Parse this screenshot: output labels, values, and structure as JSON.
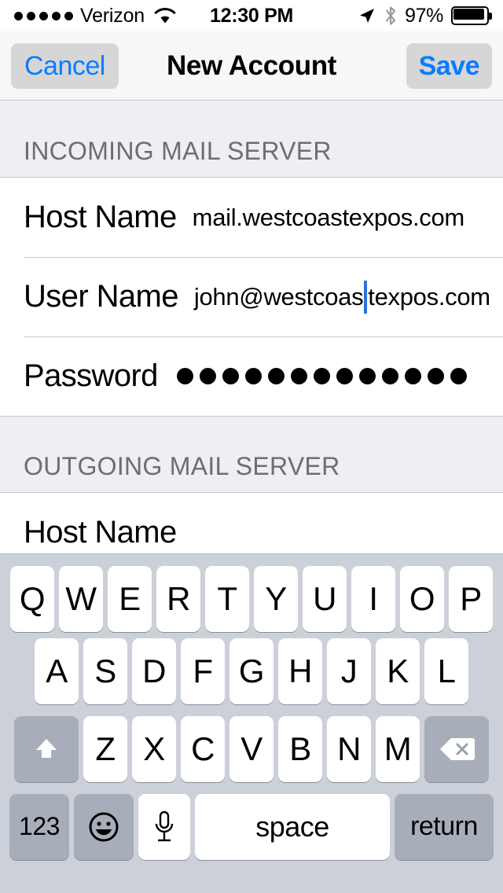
{
  "status_bar": {
    "signal_dots": 5,
    "carrier": "Verizon",
    "wifi_icon": "wifi-icon",
    "time": "12:30 PM",
    "location_icon": "location-arrow-icon",
    "bluetooth_icon": "bluetooth-icon",
    "battery_percent": "97%",
    "battery_icon": "battery-icon"
  },
  "nav_bar": {
    "cancel_label": "Cancel",
    "title": "New Account",
    "save_label": "Save",
    "accent_color": "#0a7cff",
    "button_bg": "#d6d6d6"
  },
  "form": {
    "sections": [
      {
        "header": "INCOMING MAIL SERVER",
        "rows": [
          {
            "label": "Host Name",
            "value": "mail.westcoastexpos.com",
            "type": "text"
          },
          {
            "label": "User Name",
            "value_before_caret": "john@westcoas",
            "value_after_caret": "texpos.com",
            "type": "text-editing",
            "caret_color": "#2f6fe0"
          },
          {
            "label": "Password",
            "value": "•••••••••••••",
            "dot_count": 13,
            "type": "password"
          }
        ]
      },
      {
        "header": "OUTGOING MAIL SERVER",
        "rows": [
          {
            "label": "Host Name",
            "value": "",
            "type": "text",
            "partially_hidden": true
          }
        ]
      }
    ]
  },
  "keyboard": {
    "row1": [
      "Q",
      "W",
      "E",
      "R",
      "T",
      "Y",
      "U",
      "I",
      "O",
      "P"
    ],
    "row2": [
      "A",
      "S",
      "D",
      "F",
      "G",
      "H",
      "J",
      "K",
      "L"
    ],
    "row3_letters": [
      "Z",
      "X",
      "C",
      "V",
      "B",
      "N",
      "M"
    ],
    "shift_icon": "shift-arrow-icon",
    "delete_icon": "backspace-icon",
    "numbers_label": "123",
    "emoji_icon": "emoji-smiley-icon",
    "dictation_icon": "microphone-icon",
    "space_label": "space",
    "return_label": "return",
    "bg_color": "#ccd0d8",
    "key_color": "#ffffff",
    "modifier_key_color": "#a8aeb9"
  }
}
